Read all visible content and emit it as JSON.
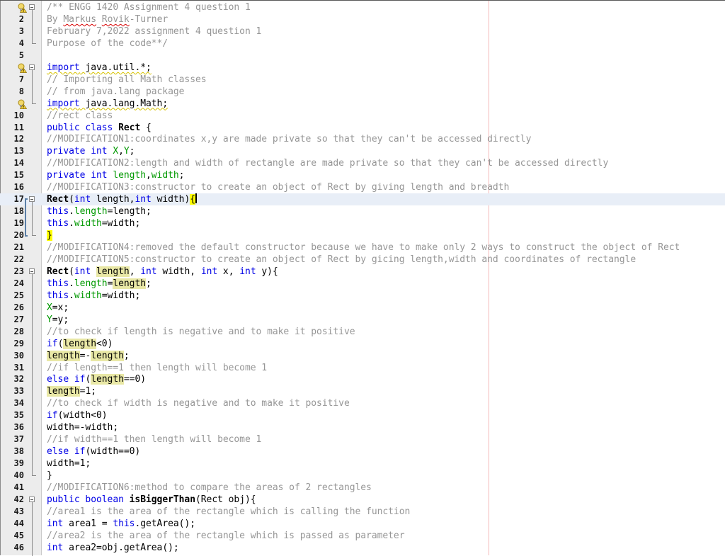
{
  "editor": {
    "current_line": 17,
    "right_margin_column": 80,
    "lines": [
      {
        "n": "",
        "hint": true,
        "fold": "start",
        "tokens": [
          {
            "t": "/** ENGG 1420 Assignment 4 question 1",
            "c": "c"
          }
        ]
      },
      {
        "n": "2",
        "tokens": [
          {
            "t": "By ",
            "c": "c"
          },
          {
            "t": "Markus",
            "c": "c squig"
          },
          {
            "t": " ",
            "c": "c"
          },
          {
            "t": "Rovik",
            "c": "c squig"
          },
          {
            "t": "-Turner",
            "c": "c"
          }
        ]
      },
      {
        "n": "3",
        "tokens": [
          {
            "t": "February 7,2022 assignment 4 question 1",
            "c": "c"
          }
        ]
      },
      {
        "n": "4",
        "fold": "end",
        "tokens": [
          {
            "t": "Purpose of the code**/",
            "c": "c"
          }
        ]
      },
      {
        "n": "5",
        "tokens": []
      },
      {
        "n": "",
        "hint": true,
        "fold": "start",
        "tokens": [
          {
            "t": "import",
            "c": "k warnline"
          },
          {
            "t": " java.util.*;",
            "c": "warnline"
          }
        ]
      },
      {
        "n": "7",
        "tokens": [
          {
            "t": "// Importing all Math classes",
            "c": "c"
          }
        ]
      },
      {
        "n": "8",
        "tokens": [
          {
            "t": "// from java.lang package",
            "c": "c"
          }
        ]
      },
      {
        "n": "",
        "hint": true,
        "fold": "end",
        "tokens": [
          {
            "t": "import",
            "c": "k warnline"
          },
          {
            "t": " java.lang.Math;",
            "c": "warnline"
          }
        ]
      },
      {
        "n": "10",
        "tokens": [
          {
            "t": "//rect class",
            "c": "c"
          }
        ]
      },
      {
        "n": "11",
        "tokens": [
          {
            "t": "public class ",
            "c": "k"
          },
          {
            "t": "Rect",
            "c": "b"
          },
          {
            "t": " {",
            "c": ""
          }
        ]
      },
      {
        "n": "12",
        "tokens": [
          {
            "t": "//MODIFICATION1:coordinates x,y are made private so that they can't be accessed directly",
            "c": "c"
          }
        ]
      },
      {
        "n": "13",
        "tokens": [
          {
            "t": "private int ",
            "c": "k"
          },
          {
            "t": "X",
            "c": "f"
          },
          {
            "t": ",",
            "c": ""
          },
          {
            "t": "Y",
            "c": "f"
          },
          {
            "t": ";",
            "c": ""
          }
        ]
      },
      {
        "n": "14",
        "tokens": [
          {
            "t": "//MODIFICATION2:length and width of rectangle are made private so that they can't be accessed directly",
            "c": "c"
          }
        ]
      },
      {
        "n": "15",
        "tokens": [
          {
            "t": "private int ",
            "c": "k"
          },
          {
            "t": "length",
            "c": "f"
          },
          {
            "t": ",",
            "c": ""
          },
          {
            "t": "width",
            "c": "f"
          },
          {
            "t": ";",
            "c": ""
          }
        ]
      },
      {
        "n": "16",
        "tokens": [
          {
            "t": "//MODIFICATION3:constructor to create an object of Rect by giving length and breadth",
            "c": "c"
          }
        ]
      },
      {
        "n": "17",
        "fold": "start",
        "tokens": [
          {
            "t": "Rect",
            "c": "b"
          },
          {
            "t": "(",
            "c": ""
          },
          {
            "t": "int",
            "c": "k"
          },
          {
            "t": " length,",
            "c": ""
          },
          {
            "t": "int",
            "c": "k"
          },
          {
            "t": " width)",
            "c": ""
          },
          {
            "t": "{",
            "c": "hl-brace"
          }
        ]
      },
      {
        "n": "18",
        "tokens": [
          {
            "t": "this",
            "c": "k"
          },
          {
            "t": ".",
            "c": ""
          },
          {
            "t": "length",
            "c": "f"
          },
          {
            "t": "=length;",
            "c": ""
          }
        ]
      },
      {
        "n": "19",
        "tokens": [
          {
            "t": "this",
            "c": "k"
          },
          {
            "t": ".",
            "c": ""
          },
          {
            "t": "width",
            "c": "f"
          },
          {
            "t": "=width;",
            "c": ""
          }
        ]
      },
      {
        "n": "20",
        "fold": "end",
        "tokens": [
          {
            "t": "}",
            "c": "hl-brace"
          }
        ]
      },
      {
        "n": "21",
        "tokens": [
          {
            "t": "//MODIFICATION4:removed the default constructor because we have to make only 2 ways to construct the object of Rect",
            "c": "c"
          }
        ]
      },
      {
        "n": "22",
        "tokens": [
          {
            "t": "//MODIFICATION5:constructor to create an object of Rect by gicing length,width and coordinates of rectangle",
            "c": "c"
          }
        ]
      },
      {
        "n": "23",
        "fold": "start",
        "tokens": [
          {
            "t": "Rect",
            "c": "b"
          },
          {
            "t": "(",
            "c": ""
          },
          {
            "t": "int",
            "c": "k"
          },
          {
            "t": " ",
            "c": ""
          },
          {
            "t": "length",
            "c": "hl"
          },
          {
            "t": ", ",
            "c": ""
          },
          {
            "t": "int",
            "c": "k"
          },
          {
            "t": " width, ",
            "c": ""
          },
          {
            "t": "int",
            "c": "k"
          },
          {
            "t": " x, ",
            "c": ""
          },
          {
            "t": "int",
            "c": "k"
          },
          {
            "t": " y){",
            "c": ""
          }
        ]
      },
      {
        "n": "24",
        "tokens": [
          {
            "t": "this",
            "c": "k"
          },
          {
            "t": ".",
            "c": ""
          },
          {
            "t": "length",
            "c": "f"
          },
          {
            "t": "=",
            "c": ""
          },
          {
            "t": "length",
            "c": "hl"
          },
          {
            "t": ";",
            "c": ""
          }
        ]
      },
      {
        "n": "25",
        "tokens": [
          {
            "t": "this",
            "c": "k"
          },
          {
            "t": ".",
            "c": ""
          },
          {
            "t": "width",
            "c": "f"
          },
          {
            "t": "=width;",
            "c": ""
          }
        ]
      },
      {
        "n": "26",
        "tokens": [
          {
            "t": "X",
            "c": "f"
          },
          {
            "t": "=x;",
            "c": ""
          }
        ]
      },
      {
        "n": "27",
        "tokens": [
          {
            "t": "Y",
            "c": "f"
          },
          {
            "t": "=y;",
            "c": ""
          }
        ]
      },
      {
        "n": "28",
        "tokens": [
          {
            "t": "//to check if length is negative and to make it positive",
            "c": "c"
          }
        ]
      },
      {
        "n": "29",
        "tokens": [
          {
            "t": "if",
            "c": "k"
          },
          {
            "t": "(",
            "c": ""
          },
          {
            "t": "length",
            "c": "hl"
          },
          {
            "t": "<0)",
            "c": ""
          }
        ]
      },
      {
        "n": "30",
        "tokens": [
          {
            "t": "length",
            "c": "hl"
          },
          {
            "t": "=-",
            "c": ""
          },
          {
            "t": "length",
            "c": "hl"
          },
          {
            "t": ";",
            "c": ""
          }
        ]
      },
      {
        "n": "31",
        "tokens": [
          {
            "t": "//if length==1 then length will become 1",
            "c": "c"
          }
        ]
      },
      {
        "n": "32",
        "tokens": [
          {
            "t": "else if",
            "c": "k"
          },
          {
            "t": "(",
            "c": ""
          },
          {
            "t": "length",
            "c": "hl"
          },
          {
            "t": "==0)",
            "c": ""
          }
        ]
      },
      {
        "n": "33",
        "tokens": [
          {
            "t": "length",
            "c": "hl"
          },
          {
            "t": "=1;",
            "c": ""
          }
        ]
      },
      {
        "n": "34",
        "tokens": [
          {
            "t": "//to check if width is negative and to make it positive",
            "c": "c"
          }
        ]
      },
      {
        "n": "35",
        "tokens": [
          {
            "t": "if",
            "c": "k"
          },
          {
            "t": "(width<0)",
            "c": ""
          }
        ]
      },
      {
        "n": "36",
        "tokens": [
          {
            "t": "width=-width;",
            "c": ""
          }
        ]
      },
      {
        "n": "37",
        "tokens": [
          {
            "t": "//if width==1 then length will become 1",
            "c": "c"
          }
        ]
      },
      {
        "n": "38",
        "tokens": [
          {
            "t": "else if",
            "c": "k"
          },
          {
            "t": "(width==0)",
            "c": ""
          }
        ]
      },
      {
        "n": "39",
        "tokens": [
          {
            "t": "width=1;",
            "c": ""
          }
        ]
      },
      {
        "n": "40",
        "fold": "end",
        "tokens": [
          {
            "t": "}",
            "c": ""
          }
        ]
      },
      {
        "n": "41",
        "tokens": [
          {
            "t": "//MODIFICATION6:method to compare the areas of 2 rectangles",
            "c": "c"
          }
        ]
      },
      {
        "n": "42",
        "fold": "start",
        "tokens": [
          {
            "t": "public boolean ",
            "c": "k"
          },
          {
            "t": "isBiggerThan",
            "c": "b"
          },
          {
            "t": "(Rect obj){",
            "c": ""
          }
        ]
      },
      {
        "n": "43",
        "tokens": [
          {
            "t": "//area1 is the area of the rectangle which is calling the function",
            "c": "c"
          }
        ]
      },
      {
        "n": "44",
        "tokens": [
          {
            "t": "int",
            "c": "k"
          },
          {
            "t": " area1 = ",
            "c": ""
          },
          {
            "t": "this",
            "c": "k"
          },
          {
            "t": ".getArea();",
            "c": ""
          }
        ]
      },
      {
        "n": "45",
        "tokens": [
          {
            "t": "//area2 is the area of the rectangle which is passed as parameter",
            "c": "c"
          }
        ]
      },
      {
        "n": "46",
        "tokens": [
          {
            "t": "int",
            "c": "k"
          },
          {
            "t": " area2=obj.getArea();",
            "c": ""
          }
        ]
      }
    ]
  }
}
